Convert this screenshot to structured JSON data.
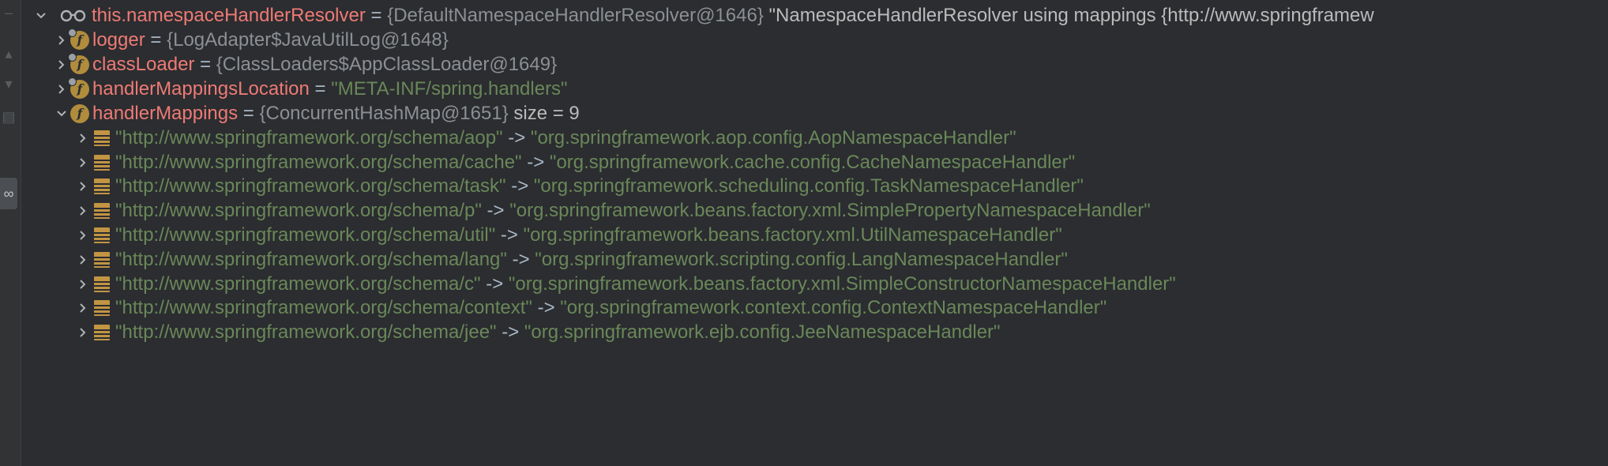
{
  "root": {
    "name": "this.namespaceHandlerResolver",
    "eq": " = ",
    "type": "{DefaultNamespaceHandlerResolver@1646}",
    "description": " \"NamespaceHandlerResolver using mappings {http://www.springframew"
  },
  "fields": [
    {
      "name": "logger",
      "eq": " = ",
      "value": "{LogAdapter$JavaUtilLog@1648}",
      "kind": "object",
      "icon": "field-icon"
    },
    {
      "name": "classLoader",
      "eq": " = ",
      "value": "{ClassLoaders$AppClassLoader@1649}",
      "kind": "object",
      "icon": "field-icon"
    },
    {
      "name": "handlerMappingsLocation",
      "eq": " = ",
      "value": "\"META-INF/spring.handlers\"",
      "kind": "string",
      "icon": "field-icon"
    },
    {
      "name": "handlerMappings",
      "eq": " = ",
      "value": "{ConcurrentHashMap@1651}",
      "extra": "  size = 9",
      "kind": "object",
      "icon": "field-icon"
    }
  ],
  "entries": [
    {
      "key": "\"http://www.springframework.org/schema/aop\"",
      "arrow": " -> ",
      "value": "\"org.springframework.aop.config.AopNamespaceHandler\""
    },
    {
      "key": "\"http://www.springframework.org/schema/cache\"",
      "arrow": " -> ",
      "value": "\"org.springframework.cache.config.CacheNamespaceHandler\""
    },
    {
      "key": "\"http://www.springframework.org/schema/task\"",
      "arrow": " -> ",
      "value": "\"org.springframework.scheduling.config.TaskNamespaceHandler\""
    },
    {
      "key": "\"http://www.springframework.org/schema/p\"",
      "arrow": " -> ",
      "value": "\"org.springframework.beans.factory.xml.SimplePropertyNamespaceHandler\""
    },
    {
      "key": "\"http://www.springframework.org/schema/util\"",
      "arrow": " -> ",
      "value": "\"org.springframework.beans.factory.xml.UtilNamespaceHandler\""
    },
    {
      "key": "\"http://www.springframework.org/schema/lang\"",
      "arrow": " -> ",
      "value": "\"org.springframework.scripting.config.LangNamespaceHandler\""
    },
    {
      "key": "\"http://www.springframework.org/schema/c\"",
      "arrow": " -> ",
      "value": "\"org.springframework.beans.factory.xml.SimpleConstructorNamespaceHandler\""
    },
    {
      "key": "\"http://www.springframework.org/schema/context\"",
      "arrow": " -> ",
      "value": "\"org.springframework.context.config.ContextNamespaceHandler\""
    },
    {
      "key": "\"http://www.springframework.org/schema/jee\"",
      "arrow": " -> ",
      "value": "\"org.springframework.ejb.config.JeeNamespaceHandler\""
    }
  ],
  "colors": {
    "background": "#2b2d30",
    "field_name": "#ee7a75",
    "string_value": "#6a8759",
    "object_value": "#8c8f93",
    "field_icon": "#b08c3c",
    "map_entry_icon": "#c29443"
  }
}
